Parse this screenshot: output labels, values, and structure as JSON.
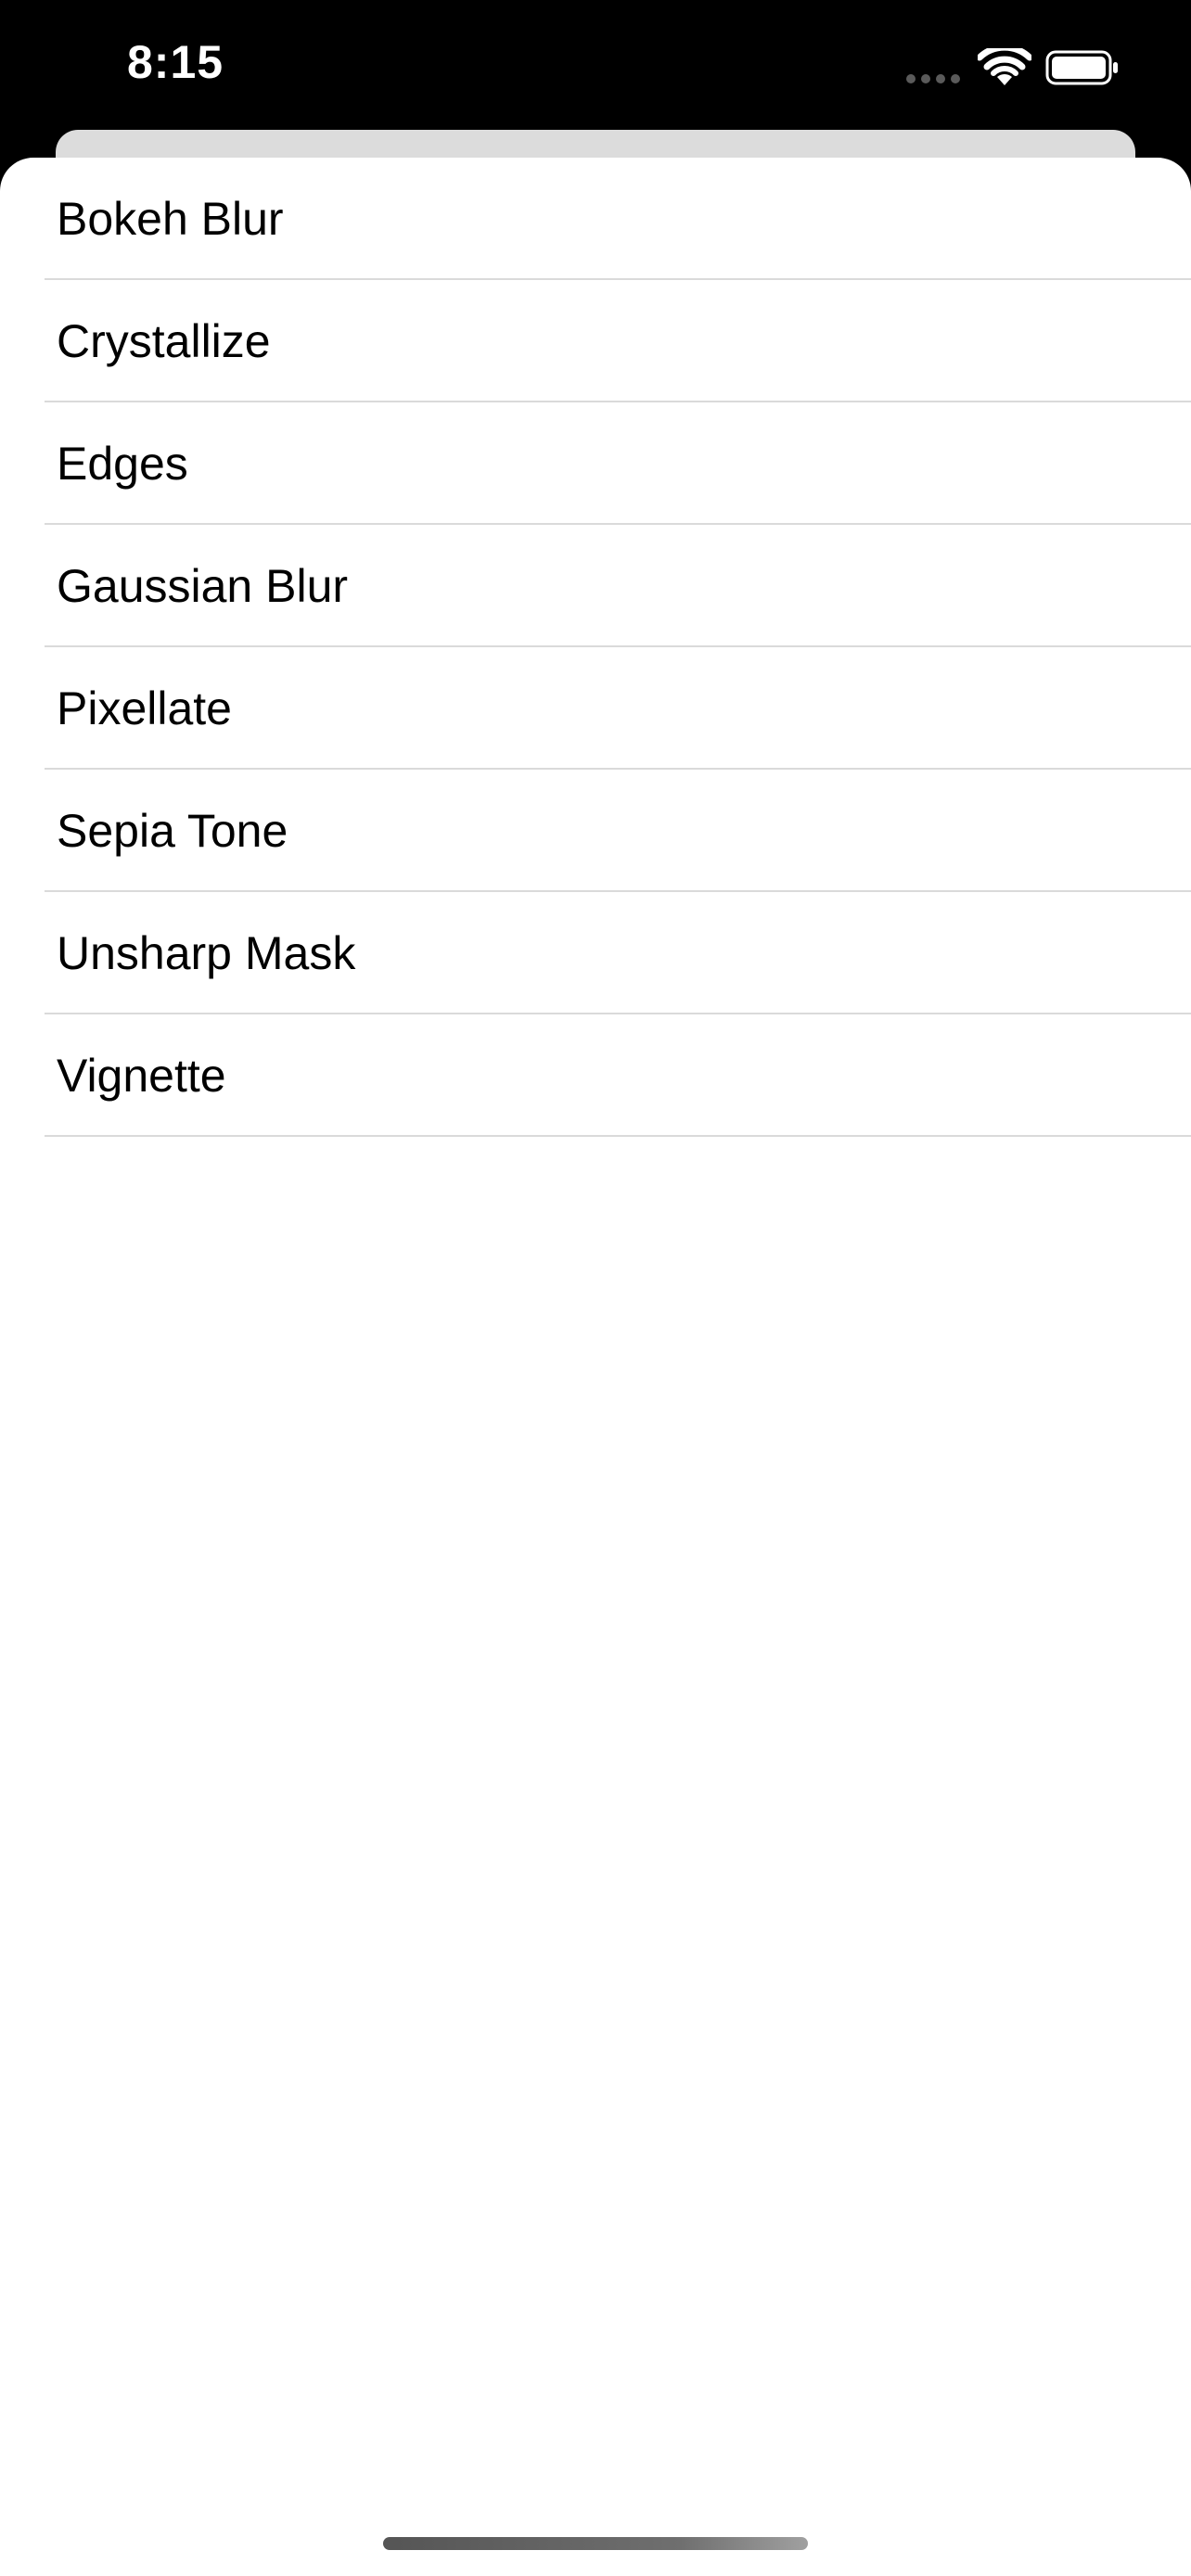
{
  "status_bar": {
    "time": "8:15",
    "icons": [
      "cellular-dots-icon",
      "wifi-icon",
      "battery-icon"
    ]
  },
  "filters": {
    "items": [
      {
        "label": "Bokeh Blur"
      },
      {
        "label": "Crystallize"
      },
      {
        "label": "Edges"
      },
      {
        "label": "Gaussian Blur"
      },
      {
        "label": "Pixellate"
      },
      {
        "label": "Sepia Tone"
      },
      {
        "label": "Unsharp Mask"
      },
      {
        "label": "Vignette"
      }
    ]
  },
  "colors": {
    "background": "#000000",
    "sheet": "#ffffff",
    "back_sheet": "#dcdcdc",
    "separator": "#dadada",
    "text": "#000000"
  }
}
